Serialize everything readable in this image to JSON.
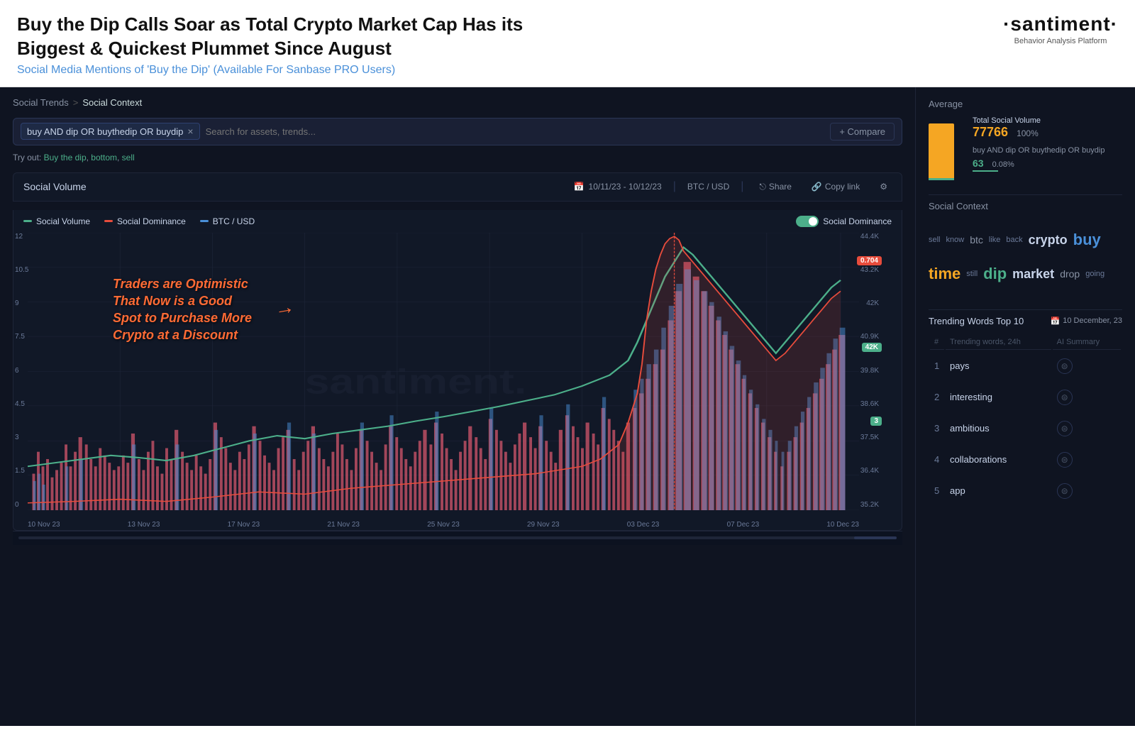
{
  "header": {
    "title": "Buy the Dip Calls Soar as Total Crypto Market Cap Has its Biggest & Quickest Plummet Since August",
    "subtitle": "Social Media Mentions of 'Buy the Dip' (Available For Sanbase PRO Users)",
    "brand_name": "·santiment·",
    "brand_sub": "Behavior Analysis Platform"
  },
  "breadcrumb": {
    "link": "Social Trends",
    "sep": ">",
    "current": "Social Context"
  },
  "search": {
    "term": "buy AND dip OR buythedip OR buydip",
    "placeholder": "Search for assets, trends...",
    "compare_label": "+ Compare"
  },
  "tryout": {
    "prefix": "Try out:",
    "links": [
      "Buy the dip",
      "bottom",
      "sell"
    ]
  },
  "chart": {
    "title": "Social Volume",
    "date_range": "10/11/23 - 10/12/23",
    "currency": "BTC / USD",
    "share_label": "Share",
    "copy_label": "Copy link",
    "legend": {
      "social_volume": "Social Volume",
      "social_dominance": "Social Dominance",
      "btc_usd": "BTC / USD"
    },
    "toggle_label": "Social Dominance",
    "annotation": {
      "line1": "Traders are Optimistic",
      "line2": "That Now is a Good",
      "line3": "Spot to Purchase More",
      "line4": "Crypto at a Discount"
    },
    "y_left": [
      "12",
      "10.5",
      "9",
      "7.5",
      "6",
      "4.5",
      "3",
      "1.5",
      "0"
    ],
    "y_right": [
      "44.4K",
      "43.2K",
      "42K",
      "40.9K",
      "39.8K",
      "38.6K",
      "37.5K",
      "36.4K",
      "35.2K"
    ],
    "x_labels": [
      "10 Nov 23",
      "13 Nov 23",
      "17 Nov 23",
      "21 Nov 23",
      "25 Nov 23",
      "29 Nov 23",
      "03 Dec 23",
      "07 Dec 23",
      "10 Dec 23"
    ],
    "badges": [
      {
        "label": "0.704",
        "color": "#e74c3c",
        "x": "93%",
        "y": "8%"
      },
      {
        "label": "42K",
        "color": "#4caf8a",
        "x": "93%",
        "y": "38%"
      },
      {
        "label": "3",
        "color": "#4caf8a",
        "x": "93%",
        "y": "65%"
      }
    ]
  },
  "average": {
    "section_title": "Average",
    "total_label": "Total Social Volume",
    "total_value": "77766",
    "total_pct": "100%",
    "query_label": "buy AND dip OR buythedip OR buydip",
    "query_value": "63",
    "query_pct": "0.08%"
  },
  "social_context": {
    "section_title": "Social Context",
    "words": [
      {
        "text": "sell",
        "size": "sm"
      },
      {
        "text": "know",
        "size": "sm"
      },
      {
        "text": "btc",
        "size": "md"
      },
      {
        "text": "like",
        "size": "sm"
      },
      {
        "text": "back",
        "size": "sm"
      },
      {
        "text": "crypto",
        "size": "lg"
      },
      {
        "text": "buy",
        "size": "xl",
        "accent": "blue"
      },
      {
        "text": "time",
        "size": "xl",
        "accent": "orange"
      },
      {
        "text": "still",
        "size": "sm"
      },
      {
        "text": "dip",
        "size": "xl",
        "accent": "green"
      },
      {
        "text": "market",
        "size": "lg"
      },
      {
        "text": "drop",
        "size": "md"
      },
      {
        "text": "going",
        "size": "sm"
      }
    ]
  },
  "trending": {
    "section_title": "Trending Words Top 10",
    "date_label": "10 December, 23",
    "columns": {
      "num": "#",
      "word": "Trending words, 24h",
      "summary": "AI Summary"
    },
    "rows": [
      {
        "num": 1,
        "word": "pays"
      },
      {
        "num": 2,
        "word": "interesting"
      },
      {
        "num": 3,
        "word": "ambitious"
      },
      {
        "num": 4,
        "word": "collaborations"
      },
      {
        "num": 5,
        "word": "app"
      }
    ]
  }
}
